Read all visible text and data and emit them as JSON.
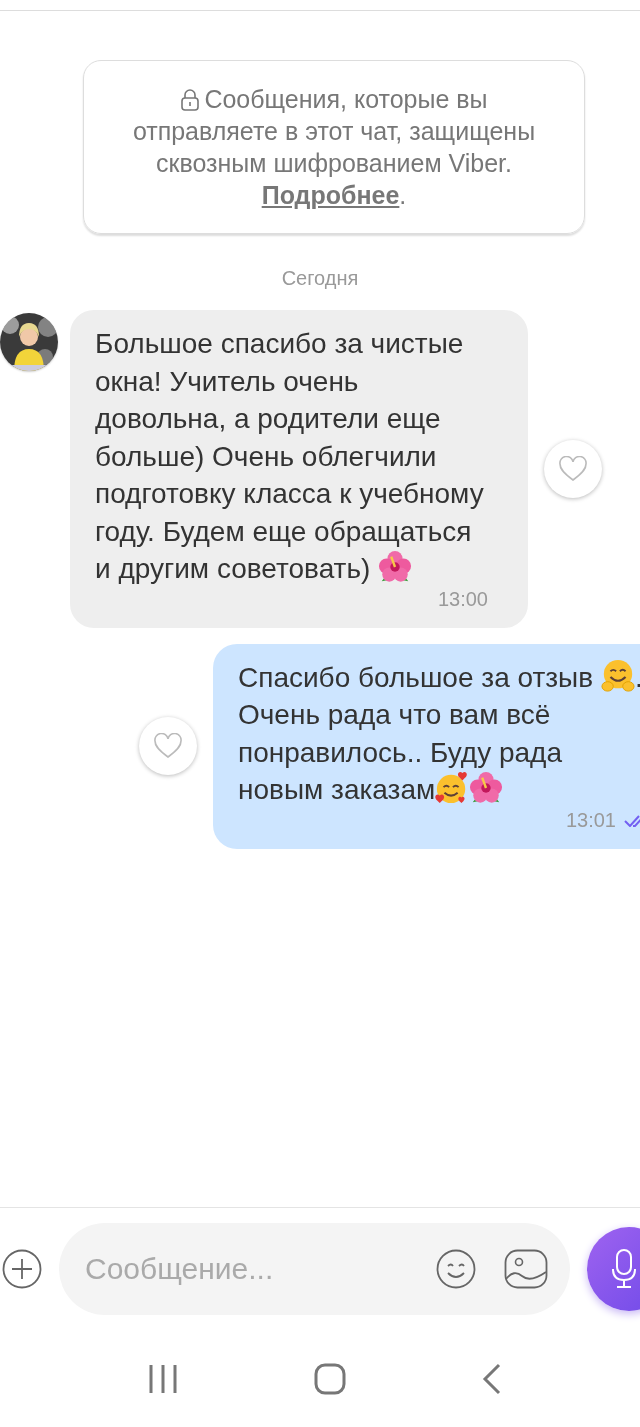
{
  "notice": {
    "text": "Сообщения, которые вы отправляете в этот чат, защищены сквозным шифрованием Viber.",
    "link": "Подробнее",
    "link_suffix": "."
  },
  "date_divider": "Сегодня",
  "messages": [
    {
      "kind": "incoming",
      "segments": [
        {
          "kind": "text",
          "text": "Большое спасибо за чистые окна! Учитель очень довольна, а родители еще больше) Очень облегчили подготовку класса к учебному году. Будем еще обращаться и другим советовать) "
        },
        {
          "kind": "hibiscus"
        }
      ],
      "time": "13:00",
      "liked": false
    },
    {
      "kind": "outgoing",
      "segments": [
        {
          "kind": "text",
          "text": "Спасибо большое за отзыв "
        },
        {
          "kind": "hug"
        },
        {
          "kind": "text",
          "text": ". Очень рада что вам всё понравилось.. Буду рада новым заказам"
        },
        {
          "kind": "hearts"
        },
        {
          "kind": "hibiscus"
        }
      ],
      "time": "13:01",
      "liked": false,
      "read": true
    }
  ],
  "composer": {
    "placeholder": "Сообщение..."
  }
}
